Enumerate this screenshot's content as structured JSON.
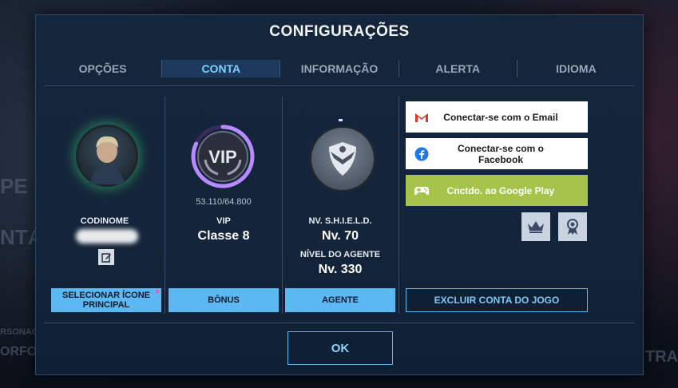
{
  "background": {
    "left_text_1": "PE",
    "left_text_2": "NTÁ",
    "left_text_3": "RSONAGE",
    "left_text_4": "ORFO",
    "right_text": "TRAR"
  },
  "dialog": {
    "title": "CONFIGURAÇÕES",
    "tabs": [
      {
        "label": "OPÇÕES",
        "active": false
      },
      {
        "label": "CONTA",
        "active": true
      },
      {
        "label": "INFORMAÇÃO",
        "active": false
      },
      {
        "label": "ALERTA",
        "active": false
      },
      {
        "label": "IDIOMA",
        "active": false
      }
    ],
    "profile": {
      "codename_label": "CODINOME",
      "select_icon_button": "SELECIONAR ÍCONE PRINCIPAL"
    },
    "vip": {
      "badge_text": "VIP",
      "progress": "53.110/64.800",
      "progress_fraction": 0.82,
      "label": "VIP",
      "value": "Classe 8",
      "bonus_button": "BÔNUS"
    },
    "shield": {
      "level_label": "NV. S.H.I.E.L.D.",
      "level_value": "Nv. 70",
      "agent_label": "NÍVEL DO AGENTE",
      "agent_value": "Nv. 330",
      "agent_button": "AGENTE"
    },
    "account": {
      "email_button": "Conectar-se com o Email",
      "facebook_button": "Conectar-se com o Facebook",
      "google_button": "Cnctdo. ao Google Play",
      "delete_button": "EXCLUIR CONTA DO JOGO",
      "google_color": "#a6c34a"
    },
    "ok_button": "OK"
  }
}
